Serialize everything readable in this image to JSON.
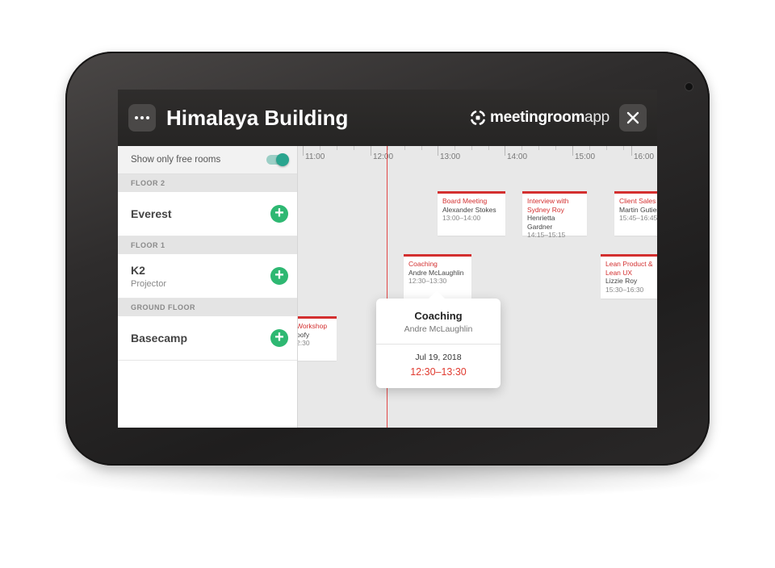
{
  "header": {
    "title": "Himalaya Building",
    "brand_bold": "meetingroom",
    "brand_light": "app"
  },
  "sidebar": {
    "filter_label": "Show only free rooms",
    "filter_on": true,
    "floors": [
      {
        "label": "FLOOR 2",
        "rooms": [
          {
            "name": "Everest",
            "subtitle": ""
          }
        ]
      },
      {
        "label": "FLOOR 1",
        "rooms": [
          {
            "name": "K2",
            "subtitle": "Projector"
          }
        ]
      },
      {
        "label": "GROUND FLOOR",
        "rooms": [
          {
            "name": "Basecamp",
            "subtitle": ""
          }
        ]
      }
    ]
  },
  "timeline": {
    "hours": [
      "11:00",
      "12:00",
      "13:00",
      "14:00",
      "15:00",
      "16:00"
    ],
    "events": [
      {
        "title": "Board Meeting",
        "person": "Alexander Stokes",
        "time": "13:00–14:00"
      },
      {
        "title": "Interview with Sydney Roy",
        "person": "Henrietta Gardner",
        "time": "14:15–15:15"
      },
      {
        "title": "Client Sales",
        "person": "Martin Gutier",
        "time": "15:45–16:45"
      },
      {
        "title": "Coaching",
        "person": "Andre McLaughlin",
        "time": "12:30–13:30"
      },
      {
        "title": "Lean Product & Lean UX",
        "person": "Lizzie Roy",
        "time": "15:30–16:30"
      },
      {
        "title": "Workshop",
        "person": "oofy",
        "time": "2:30"
      }
    ]
  },
  "popup": {
    "title": "Coaching",
    "person": "Andre McLaughlin",
    "date": "Jul 19, 2018",
    "time": "12:30–13:30"
  },
  "colors": {
    "accent_red": "#d32f2f",
    "add_green": "#2eb872",
    "toggle_teal": "#2aa58f",
    "topbar": "#2b2a29"
  }
}
